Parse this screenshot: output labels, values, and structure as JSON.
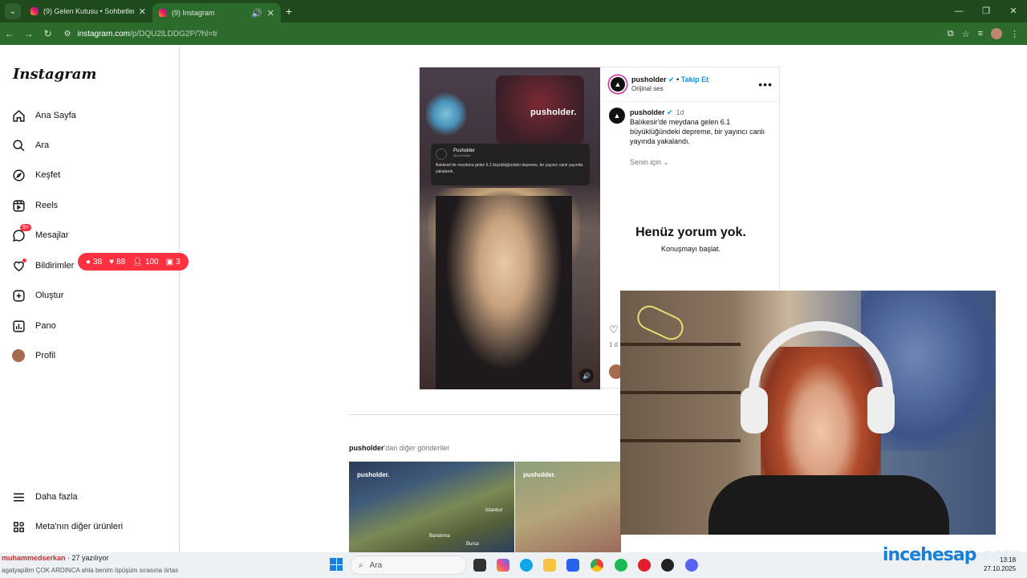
{
  "browser": {
    "tabs": [
      {
        "title": "(9) Gelen Kutusu • Sohbetler",
        "close": "✕"
      },
      {
        "title": "(9) Instagram",
        "close": "✕"
      }
    ],
    "new_tab": "+",
    "url": {
      "host": "instagram.com",
      "path": "/p/DQU2lLDDG2P/?hl=tr"
    }
  },
  "sidebar": {
    "logo": "Instagram",
    "items": [
      {
        "label": "Ana Sayfa",
        "icon": "home-icon"
      },
      {
        "label": "Ara",
        "icon": "search-icon"
      },
      {
        "label": "Keşfet",
        "icon": "compass-icon"
      },
      {
        "label": "Reels",
        "icon": "reels-icon"
      },
      {
        "label": "Mesajlar",
        "icon": "messenger-icon",
        "badge": "9+"
      },
      {
        "label": "Bildirimler",
        "icon": "heart-icon"
      },
      {
        "label": "Oluştur",
        "icon": "plus-icon"
      },
      {
        "label": "Pano",
        "icon": "dashboard-icon"
      },
      {
        "label": "Profil",
        "icon": "avatar"
      }
    ],
    "bottom": [
      {
        "label": "Daha fazla",
        "icon": "menu-icon"
      },
      {
        "label": "Meta'nın diğer ürünleri",
        "icon": "apps-icon"
      }
    ]
  },
  "notifications_pill": {
    "comments": "38",
    "likes": "88",
    "follows": "100",
    "requests": "3"
  },
  "video": {
    "watermark": "pusholder.",
    "card_name": "Pusholder",
    "card_handle": "@pusholder",
    "card_text": "Balıkesir'de meydana gelen 6.1 büyüklüğündeki depreme, bir yayıncı canlı yayında yakalandı."
  },
  "post": {
    "username": "pusholder",
    "follow": "Takip Et",
    "audio": "Orijinal ses",
    "caption": "Balıkesir'de meydana gelen 6.1 büyüklüğündeki depreme, bir yayıncı canlı yayında yakalandı.",
    "time": "1d",
    "senin_icin": "Senin için",
    "no_comments": "Henüz yorum yok.",
    "start_conversation": "Konuşmayı başlat.",
    "date_short": "1 d"
  },
  "more_posts": {
    "user": "pusholder",
    "suffix": "'dan diğer gönderiler"
  },
  "thumbs": [
    {
      "watermark": "pusholder.",
      "cities": [
        "İstanbul",
        "Bursa",
        "Bandırma"
      ]
    },
    {
      "watermark": "pusholder.",
      "cities": []
    }
  ],
  "stream_overlay": {
    "chat_user": "muhammedserkan",
    "chat_suffix": " · 27 yazılıyor",
    "chat_line2": "agatyapilim ÇOK ARDINCA ahla benim öpüşüm sırasına örtas",
    "brand_a": "ince",
    "brand_b": "hesap",
    "brand_c": ".com"
  },
  "taskbar": {
    "search": "Ara",
    "time": "13:18",
    "date": "27.10.2025"
  }
}
